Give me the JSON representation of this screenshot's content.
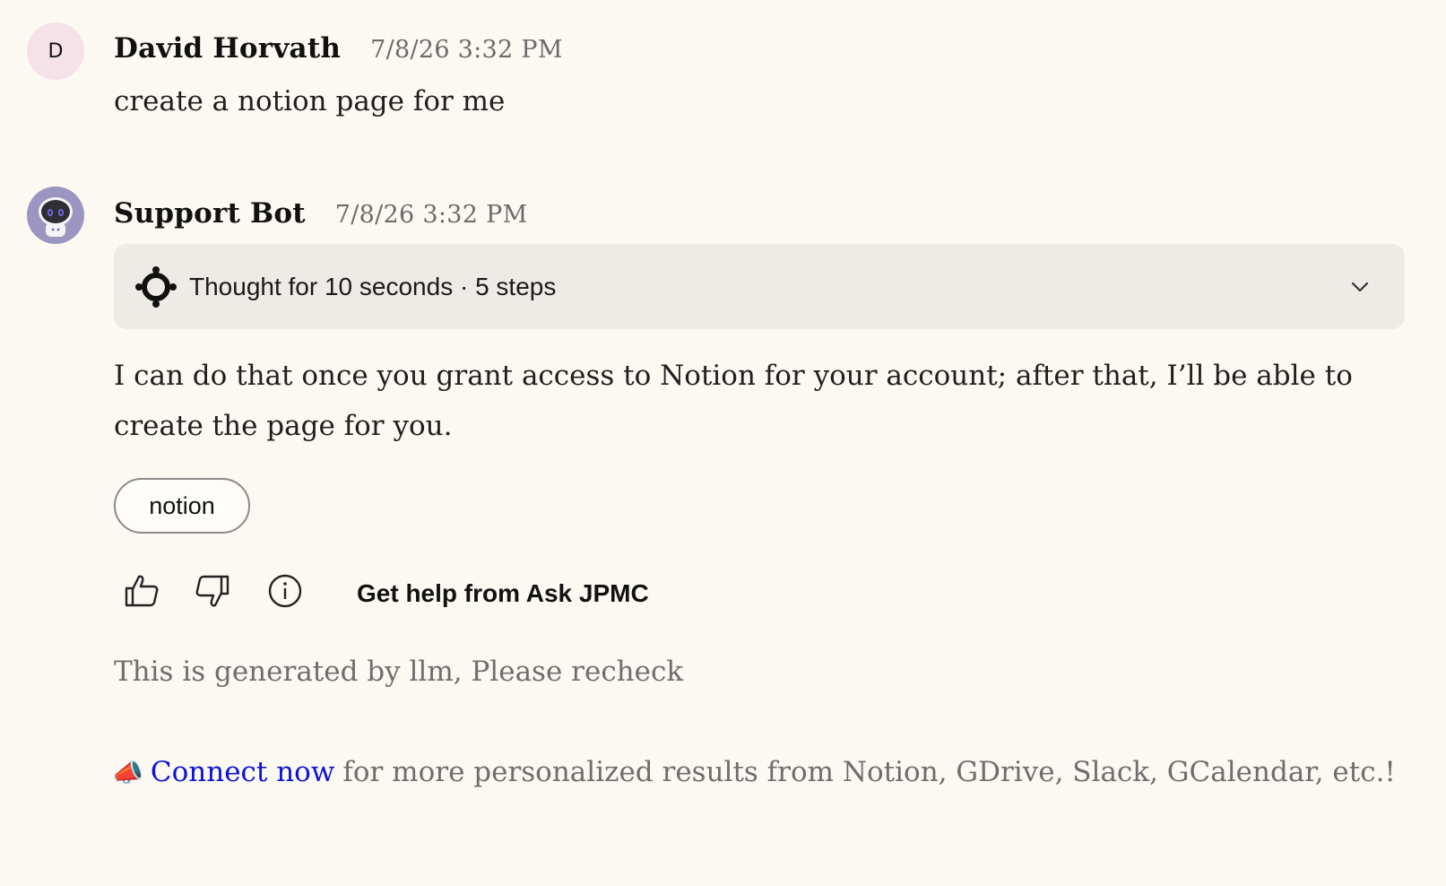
{
  "user_message": {
    "avatar_initial": "D",
    "author": "David Horvath",
    "timestamp": "7/8/26 3:32 PM",
    "text": "create a notion page for me"
  },
  "bot_message": {
    "author": "Support Bot",
    "timestamp": "7/8/26 3:32 PM",
    "thought_summary": "Thought for 10 seconds · 5 steps",
    "text": "I can do that once you grant access to Notion for your account; after that, I’ll be able to create the page for you.",
    "tags": [
      "notion"
    ],
    "actions": {
      "thumbs_up_icon": "thumbs-up-icon",
      "thumbs_down_icon": "thumbs-down-icon",
      "info_icon": "info-icon",
      "help_label": "Get help from Ask JPMC"
    },
    "disclaimer": "This is generated by llm, Please recheck"
  },
  "connect_banner": {
    "icon": "📣",
    "link_label": "Connect now",
    "text": "for more personalized results from Notion, GDrive, Slack, GCalendar, etc.!"
  },
  "colors": {
    "background": "#fcf9f3",
    "panel": "#eeebe6",
    "link": "#0b14d6",
    "user_avatar_bg": "#f5e2e8",
    "bot_avatar_bg": "#9b95c2"
  }
}
